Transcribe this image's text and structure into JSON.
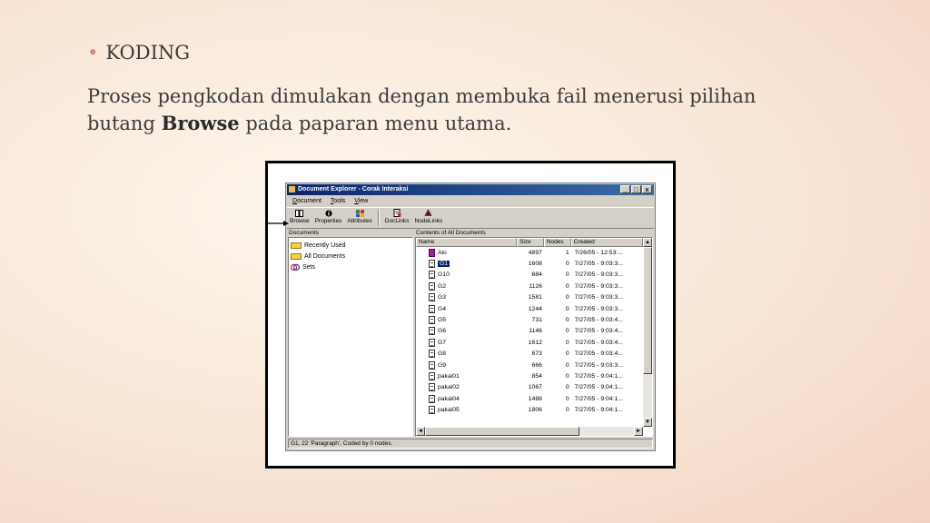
{
  "slide": {
    "bullet": "KODING",
    "body_prefix": "Proses pengkodan dimulakan dengan membuka fail menerusi pilihan butang ",
    "body_bold": "Browse",
    "body_suffix": " pada paparan menu utama."
  },
  "window": {
    "title": "Document Explorer - Corak Interaksi",
    "controls": {
      "minimize": "_",
      "maximize": "□",
      "close": "x"
    },
    "menu": [
      {
        "first": "D",
        "rest": "ocument"
      },
      {
        "first": "T",
        "rest": "ools"
      },
      {
        "first": "V",
        "rest": "iew"
      }
    ],
    "toolbar": {
      "browse": "Browse",
      "properties": "Properties",
      "attributes": "Attributes",
      "doclinks": "DocLinks",
      "nodelinks": "NodeLinks"
    },
    "left_caption": "Documents",
    "right_caption": "Contents of All Documents",
    "tree": [
      "Recently Used",
      "All Documents",
      "Sets"
    ],
    "columns": {
      "name": "Name",
      "size": "Size",
      "nodes": "Nodes",
      "created": "Created"
    },
    "rows": [
      {
        "name": "Alo",
        "size": "4897",
        "nodes": "1",
        "created": "7/26/05 - 12:53:..."
      },
      {
        "name": "G1",
        "size": "1608",
        "nodes": "0",
        "created": "7/27/05 - 9:03:3..."
      },
      {
        "name": "G10",
        "size": "684",
        "nodes": "0",
        "created": "7/27/05 - 9:03:3..."
      },
      {
        "name": "G2",
        "size": "1126",
        "nodes": "0",
        "created": "7/27/05 - 9:03:3..."
      },
      {
        "name": "G3",
        "size": "1581",
        "nodes": "0",
        "created": "7/27/05 - 9:03:3..."
      },
      {
        "name": "G4",
        "size": "1244",
        "nodes": "0",
        "created": "7/27/05 - 9:03:3..."
      },
      {
        "name": "G5",
        "size": "731",
        "nodes": "0",
        "created": "7/27/05 - 9:03:4..."
      },
      {
        "name": "G6",
        "size": "1146",
        "nodes": "0",
        "created": "7/27/05 - 9:03:4..."
      },
      {
        "name": "G7",
        "size": "1612",
        "nodes": "0",
        "created": "7/27/05 - 9:03:4..."
      },
      {
        "name": "G8",
        "size": "673",
        "nodes": "0",
        "created": "7/27/05 - 9:03:4..."
      },
      {
        "name": "G9",
        "size": "666",
        "nodes": "0",
        "created": "7/27/05 - 9:03:3..."
      },
      {
        "name": "pakai01",
        "size": "854",
        "nodes": "0",
        "created": "7/27/05 - 9:04:1..."
      },
      {
        "name": "pakai02",
        "size": "1067",
        "nodes": "0",
        "created": "7/27/05 - 9:04:1..."
      },
      {
        "name": "pakai04",
        "size": "1488",
        "nodes": "0",
        "created": "7/27/05 - 9:04:1..."
      },
      {
        "name": "pakai05",
        "size": "1806",
        "nodes": "0",
        "created": "7/27/05 - 9:04:1..."
      }
    ],
    "status": "G1, 22 'Paragraph', Coded by 0 nodes."
  },
  "colors": {
    "title_bar": "#0a246a",
    "selection": "#0a246a",
    "window_face": "#d4d0c8",
    "folder": "#f0d24a",
    "bullet": "#d88a7e"
  }
}
